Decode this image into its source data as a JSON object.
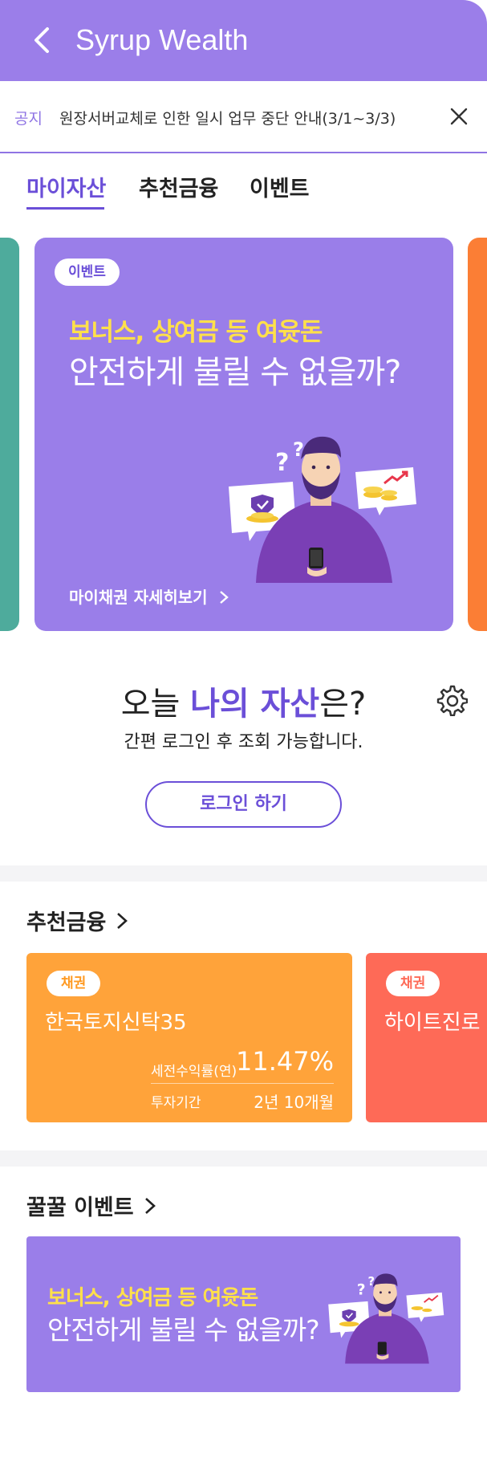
{
  "header": {
    "title": "Syrup Wealth",
    "background": "#9b7ee9"
  },
  "notice": {
    "tag": "공지",
    "text": "원장서버교체로 인한 일시 업무 중단 안내(3/1~3/3)"
  },
  "tabs": [
    {
      "label": "마이자산",
      "active": true
    },
    {
      "label": "추천금융",
      "active": false
    },
    {
      "label": "이벤트",
      "active": false
    }
  ],
  "event_card": {
    "badge": "이벤트",
    "headline": "보너스, 상여금 등 여윳돈",
    "subheadline": "안전하게 불릴 수 없을까?",
    "link": "마이채권 자세히보기"
  },
  "asset": {
    "title_prefix": "오늘 ",
    "title_strong": "나의 자산",
    "title_suffix": "은?",
    "subtitle": "간편 로그인 후 조회 가능합니다.",
    "login_button": "로그인 하기"
  },
  "recommend": {
    "section_title": "추천금융",
    "products": [
      {
        "badge": "채권",
        "name": "한국토지신탁35",
        "rate_label": "세전수익률(연)",
        "rate": "11.47%",
        "term_label": "투자기간",
        "term": "2년 10개월"
      },
      {
        "badge": "채권",
        "name": "하이트진로"
      }
    ]
  },
  "events": {
    "section_title": "꿀꿀 이벤트",
    "banner_headline": "보너스, 상여금 등 여윳돈",
    "banner_subheadline": "안전하게 불릴 수 없을까?"
  },
  "colors": {
    "accent": "#6b4fd8",
    "card_purple": "#9a7ee9",
    "highlight_yellow": "#ffe04a",
    "product_orange": "#ffa33a",
    "product_red": "#fe6a57",
    "peek_teal": "#4eab9c",
    "peek_orange": "#fb7e35"
  }
}
